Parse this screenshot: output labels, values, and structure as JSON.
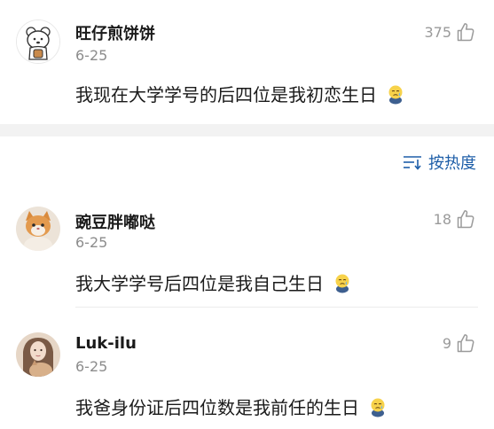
{
  "comments": [
    {
      "username": "旺仔煎饼饼",
      "date": "6-25",
      "text": "我现在大学学号的后四位是我初恋生日",
      "likes": "375",
      "avatar": "bear-cartoon-avatar",
      "emoji": "crying-face-emoji"
    },
    {
      "username": "豌豆胖嘟哒",
      "date": "6-25",
      "text": "我大学学号后四位是我自己生日",
      "likes": "18",
      "avatar": "orange-cat-avatar",
      "emoji": "crying-face-emoji"
    },
    {
      "username": "Luk-ilu",
      "date": "6-25",
      "text": "我爸身份证后四位数是我前任的生日",
      "likes": "9",
      "avatar": "girl-with-cat-avatar",
      "emoji": "crying-face-emoji"
    }
  ],
  "sort": {
    "label": "按热度",
    "icon": "sort-lines-icon"
  },
  "colors": {
    "accent": "#1e5ea8",
    "secondary_text": "#8c8c8c",
    "band": "#f2f2f2"
  }
}
